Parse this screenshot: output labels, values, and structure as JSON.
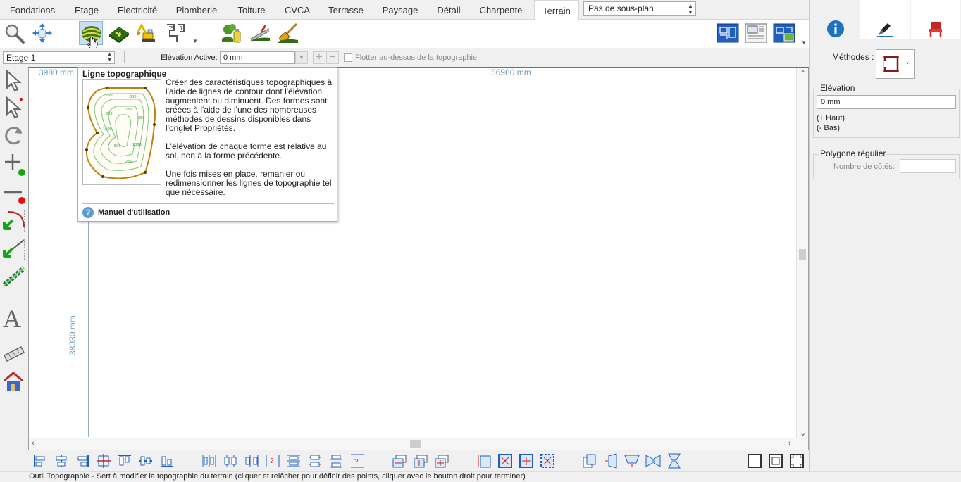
{
  "tabs": [
    {
      "label": "Fondations",
      "active": false
    },
    {
      "label": "Etage",
      "active": false
    },
    {
      "label": "Electricité",
      "active": false
    },
    {
      "label": "Plomberie",
      "active": false
    },
    {
      "label": "Toiture",
      "active": false
    },
    {
      "label": "CVCA",
      "active": false
    },
    {
      "label": "Terrasse",
      "active": false
    },
    {
      "label": "Paysage",
      "active": false
    },
    {
      "label": "Détail",
      "active": false
    },
    {
      "label": "Charpente",
      "active": false
    },
    {
      "label": "Terrain",
      "active": true
    }
  ],
  "subplan": {
    "value": "Pas de sous-plan"
  },
  "toolbar_icons": [
    "zoom-icon",
    "pan-icon",
    "topo-line-icon",
    "topo-region-icon",
    "excavator-icon",
    "path-icon",
    "tree-spray-icon",
    "trowel-icon",
    "shovel-icon",
    "plan-view-icon",
    "layout-view-icon",
    "terrain-view-icon"
  ],
  "optionbar": {
    "floor": "Etage 1",
    "elevation_label": "Elévation Active:",
    "elevation_value": "0 mm",
    "float_label": "Flotter au-dessus de la topographie"
  },
  "canvas": {
    "dim_top_left": "3980 mm",
    "dim_top_right": "56980 mm",
    "dim_left": "38030 mm"
  },
  "tooltip": {
    "title": "Ligne topographique",
    "para1": "Créer des caractéristiques topographiques à l'aide de lignes de contour dont l'élévation augmentent ou diminuent. Des formes sont créées à l'aide de l'une des nombreuses méthodes de dessins disponibles dans l'onglet Propriétés.",
    "para2": "L'élévation de chaque forme est relative au sol, non à la forme précédente.",
    "para3": "Une fois mises en place, remanier ou redimensionner les lignes de topographie tel que nécessaire.",
    "help_icon": "?",
    "help_label": "Manuel d'utilisation"
  },
  "status": {
    "text": "Outil Topographie - Sert à modifier la topographie du terrain (cliquer et relâcher pour définir des points, cliquer avec le bouton droit pour terminer)"
  },
  "right_panel": {
    "tabs": [
      "info-icon",
      "pen-icon",
      "chair-icon"
    ],
    "methods_label": "Méthodes :",
    "elevation_title": "Elévation",
    "elevation_value": "0 mm",
    "elevation_up": "(+ Haut)",
    "elevation_down": "(- Bas)",
    "polygon_title": "Polygone régulier",
    "sides_label": "Nombre de côtés:",
    "sides_value": ""
  },
  "colors": {
    "accent_blue": "#1e73be",
    "selected_bg": "#c9dff5",
    "dimension": "#6f9bb3",
    "topo_green": "#2e8b57"
  }
}
